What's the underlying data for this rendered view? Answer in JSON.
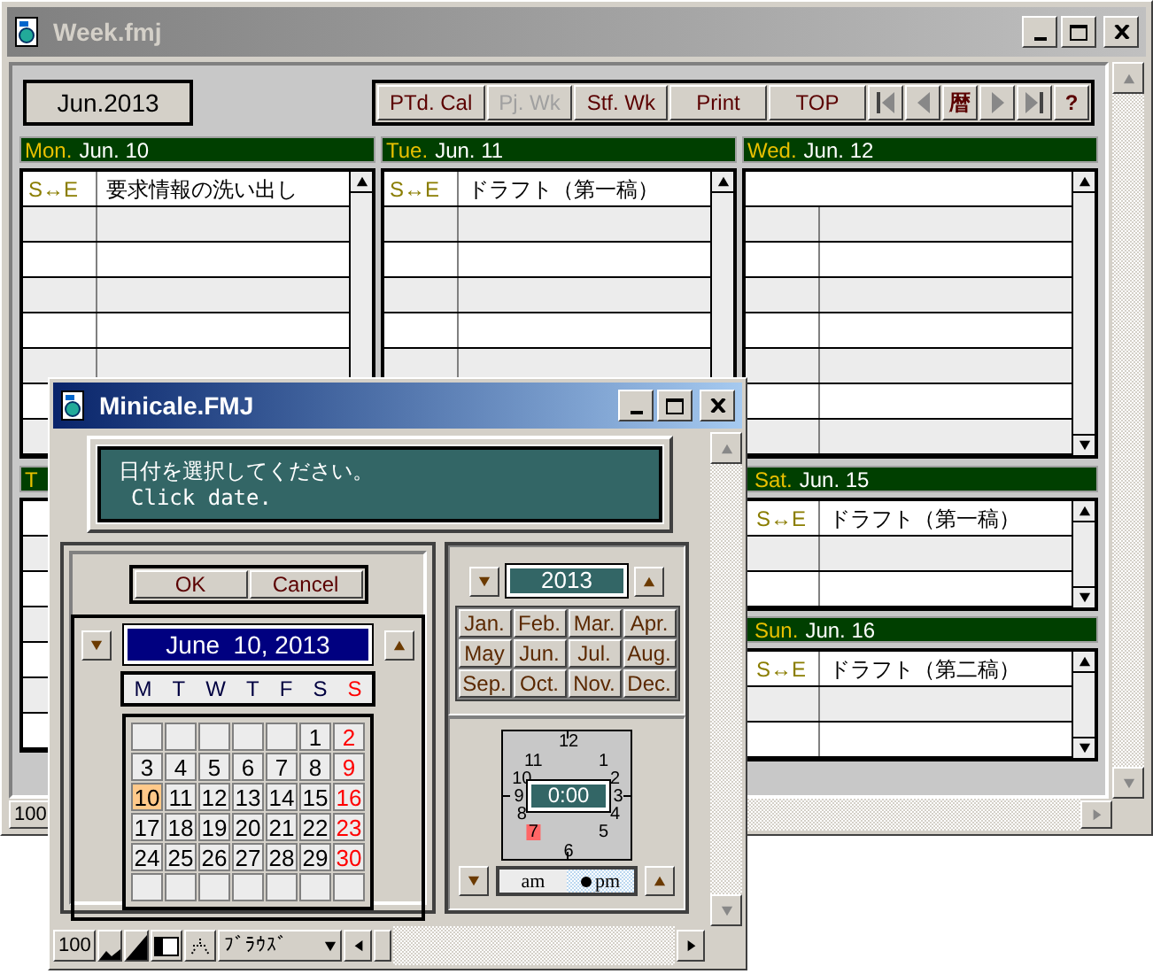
{
  "week_window": {
    "title": "Week.fmj",
    "month_label": "Jun.2013",
    "toolbar": [
      {
        "label": "PTd. Cal",
        "disabled": false
      },
      {
        "label": "Pj. Wk",
        "disabled": true
      },
      {
        "label": "Stf. Wk",
        "disabled": false
      },
      {
        "label": "Print",
        "disabled": false
      },
      {
        "label": "TOP",
        "disabled": false
      }
    ],
    "nav": [
      {
        "kind": "first"
      },
      {
        "kind": "prev"
      },
      {
        "kind": "text",
        "label": "暦"
      },
      {
        "kind": "next"
      },
      {
        "kind": "last"
      },
      {
        "kind": "text",
        "label": "?"
      }
    ],
    "top_days": [
      {
        "weekday": "Mon.",
        "date": "Jun. 10",
        "span_label": "S↔E",
        "entry": "要求情報の洗い出し"
      },
      {
        "weekday": "Tue.",
        "date": "Jun. 11",
        "span_label": "S↔E",
        "entry": "ドラフト（第一稿）"
      },
      {
        "weekday": "Wed.",
        "date": "Jun. 12"
      }
    ],
    "thu": {
      "weekday": "T"
    },
    "right_days": [
      {
        "weekday": "Sat.",
        "date": "Jun. 15",
        "span_label": "S↔E",
        "entry": "ドラフト（第一稿）"
      },
      {
        "weekday": "Sun.",
        "date": "Jun. 16",
        "span_label": "S↔E",
        "entry": "ドラフト（第二稿）"
      }
    ],
    "zoom": "100"
  },
  "minicale": {
    "title": "Minicale.FMJ",
    "message_lines": [
      "日付を選択してください。",
      "Click date."
    ],
    "buttons": [
      "OK",
      "Cancel"
    ],
    "date": "June  10, 2013",
    "weekdays": [
      {
        "label": "M",
        "holiday": false
      },
      {
        "label": "T",
        "holiday": false
      },
      {
        "label": "W",
        "holiday": false
      },
      {
        "label": "T",
        "holiday": false
      },
      {
        "label": "F",
        "holiday": false
      },
      {
        "label": "S",
        "holiday": false
      },
      {
        "label": "S",
        "holiday": true
      }
    ],
    "weeks": [
      [
        {
          "kind": "blank",
          "selected": false
        },
        {
          "kind": "blank",
          "selected": false
        },
        {
          "kind": "blank",
          "selected": false
        },
        {
          "kind": "blank",
          "selected": false
        },
        {
          "kind": "blank",
          "selected": false
        },
        {
          "kind": "day",
          "label": "1",
          "holiday": false,
          "selected": false
        },
        {
          "kind": "day",
          "label": "2",
          "holiday": true,
          "selected": false
        }
      ],
      [
        {
          "kind": "day",
          "label": "3",
          "holiday": false,
          "selected": false
        },
        {
          "kind": "day",
          "label": "4",
          "holiday": false,
          "selected": false
        },
        {
          "kind": "day",
          "label": "5",
          "holiday": false,
          "selected": false
        },
        {
          "kind": "day",
          "label": "6",
          "holiday": false,
          "selected": false
        },
        {
          "kind": "day",
          "label": "7",
          "holiday": false,
          "selected": false
        },
        {
          "kind": "day",
          "label": "8",
          "holiday": false,
          "selected": false
        },
        {
          "kind": "day",
          "label": "9",
          "holiday": true,
          "selected": false
        }
      ],
      [
        {
          "kind": "day",
          "label": "10",
          "holiday": false,
          "selected": true
        },
        {
          "kind": "day",
          "label": "11",
          "holiday": false,
          "selected": false
        },
        {
          "kind": "day",
          "label": "12",
          "holiday": false,
          "selected": false
        },
        {
          "kind": "day",
          "label": "13",
          "holiday": false,
          "selected": false
        },
        {
          "kind": "day",
          "label": "14",
          "holiday": false,
          "selected": false
        },
        {
          "kind": "day",
          "label": "15",
          "holiday": false,
          "selected": false
        },
        {
          "kind": "day",
          "label": "16",
          "holiday": true,
          "selected": false
        }
      ],
      [
        {
          "kind": "day",
          "label": "17",
          "holiday": false,
          "selected": false
        },
        {
          "kind": "day",
          "label": "18",
          "holiday": false,
          "selected": false
        },
        {
          "kind": "day",
          "label": "19",
          "holiday": false,
          "selected": false
        },
        {
          "kind": "day",
          "label": "20",
          "holiday": false,
          "selected": false
        },
        {
          "kind": "day",
          "label": "21",
          "holiday": false,
          "selected": false
        },
        {
          "kind": "day",
          "label": "22",
          "holiday": false,
          "selected": false
        },
        {
          "kind": "day",
          "label": "23",
          "holiday": true,
          "selected": false
        }
      ],
      [
        {
          "kind": "day",
          "label": "24",
          "holiday": false,
          "selected": false
        },
        {
          "kind": "day",
          "label": "25",
          "holiday": false,
          "selected": false
        },
        {
          "kind": "day",
          "label": "26",
          "holiday": false,
          "selected": false
        },
        {
          "kind": "day",
          "label": "27",
          "holiday": false,
          "selected": false
        },
        {
          "kind": "day",
          "label": "28",
          "holiday": false,
          "selected": false
        },
        {
          "kind": "day",
          "label": "29",
          "holiday": false,
          "selected": false
        },
        {
          "kind": "day",
          "label": "30",
          "holiday": true,
          "selected": false
        }
      ],
      [
        {
          "kind": "blank",
          "selected": false
        },
        {
          "kind": "blank",
          "selected": false
        },
        {
          "kind": "blank",
          "selected": false
        },
        {
          "kind": "blank",
          "selected": false
        },
        {
          "kind": "blank",
          "selected": false
        },
        {
          "kind": "blank",
          "selected": false
        },
        {
          "kind": "blank",
          "selected": false
        }
      ]
    ],
    "year": "2013",
    "months": [
      "Jan.",
      "Feb.",
      "Mar.",
      "Apr.",
      "May",
      "Jun.",
      "Jul.",
      "Aug.",
      "Sep.",
      "Oct.",
      "Nov.",
      "Dec."
    ],
    "clock": {
      "hours": [
        {
          "label": "12",
          "selected": false
        },
        {
          "label": "11",
          "selected": false
        },
        {
          "label": "1",
          "selected": false
        },
        {
          "label": "10",
          "selected": false
        },
        {
          "label": "2",
          "selected": false
        },
        {
          "label": "9",
          "selected": false
        },
        {
          "label": "3",
          "selected": false
        },
        {
          "label": "8",
          "selected": false
        },
        {
          "label": "4",
          "selected": false
        },
        {
          "label": "7",
          "selected": true
        },
        {
          "label": "5",
          "selected": false
        },
        {
          "label": "6",
          "selected": false
        }
      ],
      "time": "0:00",
      "periods": [
        {
          "label": "am",
          "selected": false
        },
        {
          "label": "pm",
          "selected": true
        }
      ]
    },
    "zoom": "100",
    "mode": "ﾌﾞﾗｳｽﾞ"
  }
}
